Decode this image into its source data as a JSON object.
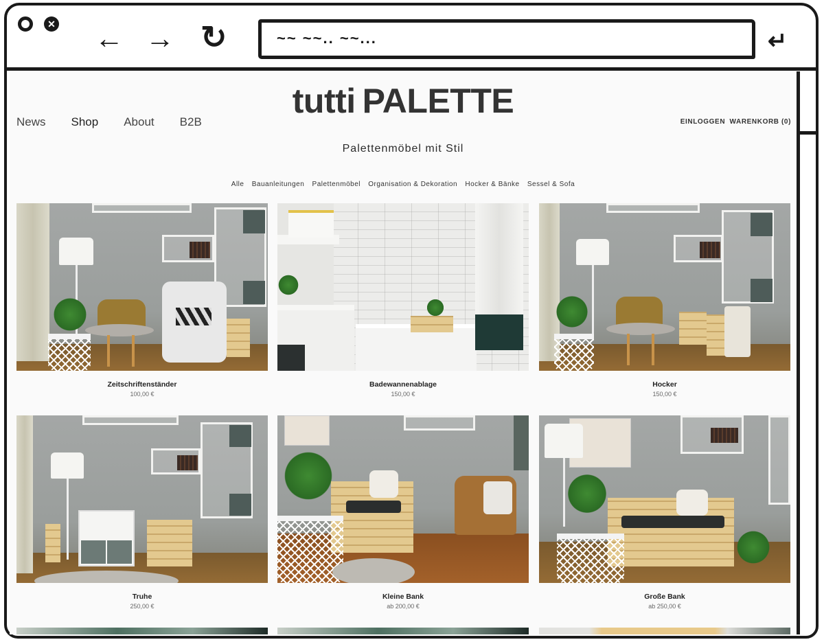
{
  "browser": {
    "address_text": "~~ ~~.. ~~...",
    "icons": {
      "window_open": "circle-icon",
      "window_close": "close-circle-icon",
      "back": "arrow-left-icon",
      "forward": "arrow-right-icon",
      "reload": "reload-icon",
      "go": "enter-return-icon"
    }
  },
  "site": {
    "logo_prefix": "tutti",
    "logo_main": "PALETTE",
    "tagline": "Palettenmöbel mit Stil",
    "nav": [
      {
        "label": "News"
      },
      {
        "label": "Shop",
        "active": true
      },
      {
        "label": "About"
      },
      {
        "label": "B2B"
      }
    ],
    "account": {
      "login": "EINLOGGEN",
      "cart": "WARENKORB (0)"
    },
    "categories": [
      "Alle",
      "Bauanleitungen",
      "Palettenmöbel",
      "Organisation & Dekoration",
      "Hocker & Bänke",
      "Sessel & Sofa"
    ]
  },
  "products": [
    {
      "name": "Zeitschriftenständer",
      "price": "100,00 €",
      "scene": "living-room-armchair"
    },
    {
      "name": "Badewannenablage",
      "price": "150,00 €",
      "scene": "bathroom-tub"
    },
    {
      "name": "Hocker",
      "price": "150,00 €",
      "scene": "living-room-crates"
    },
    {
      "name": "Truhe",
      "price": "250,00 €",
      "scene": "living-room-chest"
    },
    {
      "name": "Kleine Bank",
      "price": "ab 200,00 €",
      "scene": "pallet-bench-small"
    },
    {
      "name": "Große Bank",
      "price": "ab 250,00 €",
      "scene": "pallet-bench-large"
    }
  ],
  "colors": {
    "page_bg": "#fafafa",
    "text": "#2b2b2b",
    "frame": "#1a1a1a"
  }
}
